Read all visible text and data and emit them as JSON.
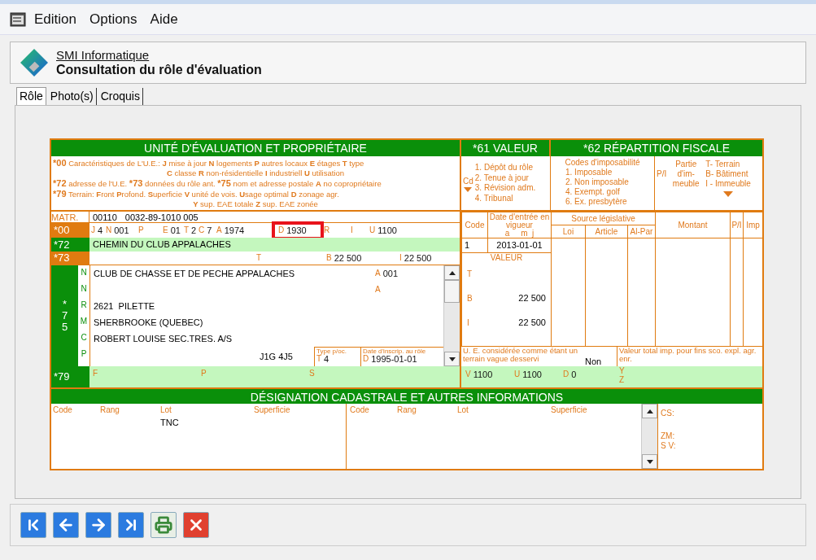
{
  "menu": [
    "Edition",
    "Options",
    "Aide"
  ],
  "header": {
    "company": "SMI Informatique",
    "title": "Consultation du rôle d'évaluation"
  },
  "tabs": [
    {
      "label": "Rôle",
      "selected": true
    },
    {
      "label": "Photo(s)",
      "selected": false
    },
    {
      "label": "Croquis",
      "selected": false
    }
  ],
  "unit": {
    "title": "UNITÉ D'ÉVALUATION ET PROPRIÉTAIRE",
    "legend": [
      [
        {
          "code": "*00",
          "text": "Caractéristiques de L'U.E.: **J** mise à jour **N** logements **P** autres locaux **E** étages **T** type"
        }
      ],
      [
        {
          "text": "**C** classe **R** non-résidentielle **I** industriell **U** utilisation"
        }
      ],
      [
        {
          "code": "*72",
          "text": "adresse de l'U.E."
        },
        {
          "code": "*73",
          "text": "données du rôle ant."
        },
        {
          "code": "*75",
          "text": "nom et adresse postale **A** no copropriétaire"
        }
      ],
      [
        {
          "code": "*79",
          "text": "Terrain: **F**ront **P**rofond. **S**uperficie **V** unité de vois. **U**sage optimal **D** zonage agr."
        }
      ],
      [
        {
          "text": "**Y** sup. EAE totale **Z** sup. EAE zonée"
        }
      ]
    ],
    "matr": {
      "label": "MATR.",
      "values": [
        "00110",
        "0032-89-1010 005"
      ]
    },
    "r00": {
      "label": "*00",
      "fields": [
        {
          "code": "J",
          "value": "4",
          "highlighted": false
        },
        {
          "code": "N",
          "value": "001",
          "highlighted": false
        },
        {
          "code": "P",
          "highlighted": false
        },
        {
          "code": "E",
          "value": "01",
          "highlighted": false
        },
        {
          "code": "T",
          "value": "2",
          "highlighted": false
        },
        {
          "code": "C",
          "value": "7",
          "highlighted": false
        },
        {
          "code": "A",
          "value": "1974",
          "highlighted": false
        },
        {
          "code": "D",
          "value": "1930",
          "highlighted": true
        },
        {
          "code": "R",
          "highlighted": false
        },
        {
          "code": "I",
          "highlighted": false
        },
        {
          "code": "U",
          "value": "1100",
          "highlighted": false
        }
      ]
    },
    "r72": {
      "label": "*72",
      "value": "CHEMIN DU CLUB APPALACHES"
    },
    "r73": {
      "label": "*73",
      "fields": [
        {
          "code": "T"
        },
        {
          "code": "B",
          "value": "22 500"
        },
        {
          "code": "I",
          "value": "22 500"
        }
      ]
    },
    "r75": {
      "label": "*75",
      "lines": [
        {
          "letter": "N",
          "text": "CLUB DE CHASSE ET DE PECHE APPALACHES",
          "extra": {
            "code": "A",
            "value": "001"
          }
        },
        {
          "letter": "N",
          "extra": {
            "code": "A"
          }
        },
        {
          "letter": "R",
          "text": "2621  PILETTE"
        },
        {
          "letter": "M",
          "text": "SHERBROOKE (QUEBEC)"
        },
        {
          "letter": "C",
          "text": "ROBERT LOUISE SEC.TRES. A/S"
        },
        {
          "letter": "P",
          "text": "J1G 4J5"
        }
      ],
      "type_poc": {
        "label": "Type p/oc.",
        "code": "T",
        "value": "4"
      },
      "date_inscription": {
        "label": "Date d'inscrip. au rôle",
        "code": "D",
        "value": "1995-01-01"
      }
    },
    "r79": {
      "label": "*79",
      "fields": [
        {
          "code": "F"
        },
        {
          "code": "P"
        },
        {
          "code": "S"
        }
      ]
    }
  },
  "valeur": {
    "title": "*61 VALEUR",
    "cd_label": "Cd",
    "cd_items": [
      "1. Dépôt du rôle",
      "2. Tenue à jour",
      "3. Révision adm.",
      "4. Tribunal"
    ]
  },
  "repartition": {
    "title": "*62 RÉPARTITION FISCALE",
    "codes_title": "Codes d'imposabilité",
    "codes": [
      "1. Imposable",
      "2. Non imposable",
      "4. Exempt. golf",
      "6. Ex. presbytère"
    ],
    "partie_pi": "P/I",
    "partie_label": "Partie d'im- meuble",
    "partie_items": [
      "T- Terrain",
      "B- Bâtiment",
      "I - Immeuble"
    ]
  },
  "table": {
    "code": "Code",
    "date": "Date d'entrée en vigueur",
    "date_sub": "a     m  j",
    "source": "Source législative",
    "loi": "Loi",
    "article": "Article",
    "alpar": "Al-Par",
    "montant": "Montant",
    "pi": "P/I",
    "imp": "Imp",
    "row": {
      "code": "1",
      "date": "2013-01-01"
    },
    "valeur_label": "VALEUR",
    "valeurs": [
      {
        "code": "T"
      },
      {
        "code": "B",
        "value": "22 500"
      },
      {
        "code": "I",
        "value": "22 500"
      }
    ]
  },
  "terrain_vague": {
    "label": "U. E. considérée comme étant un terrain vague desservi",
    "value": "Non"
  },
  "valeur_total": {
    "label": "Valeur total imp. pour fins sco. expl. agr. enr."
  },
  "r79_right": {
    "fields": [
      {
        "code": "V",
        "value": "1100"
      },
      {
        "code": "U",
        "value": "1100"
      },
      {
        "code": "D",
        "value": "0"
      }
    ],
    "yz": [
      "Y",
      "Z"
    ]
  },
  "cadastre": {
    "title": "DÉSIGNATION CADASTRALE ET AUTRES INFORMATIONS",
    "columns": [
      "Code",
      "Rang",
      "Lot",
      "Superficie"
    ],
    "left_rows": [
      {
        "lot": "TNC"
      }
    ],
    "right_columns": [
      "Code",
      "Rang",
      "Lot",
      "Superficie"
    ],
    "info": [
      "CS:",
      "ZM:",
      "S V:"
    ]
  },
  "toolbar": [
    {
      "kind": "first"
    },
    {
      "kind": "previous"
    },
    {
      "kind": "next"
    },
    {
      "kind": "last"
    },
    {
      "kind": "print"
    },
    {
      "kind": "close"
    }
  ]
}
